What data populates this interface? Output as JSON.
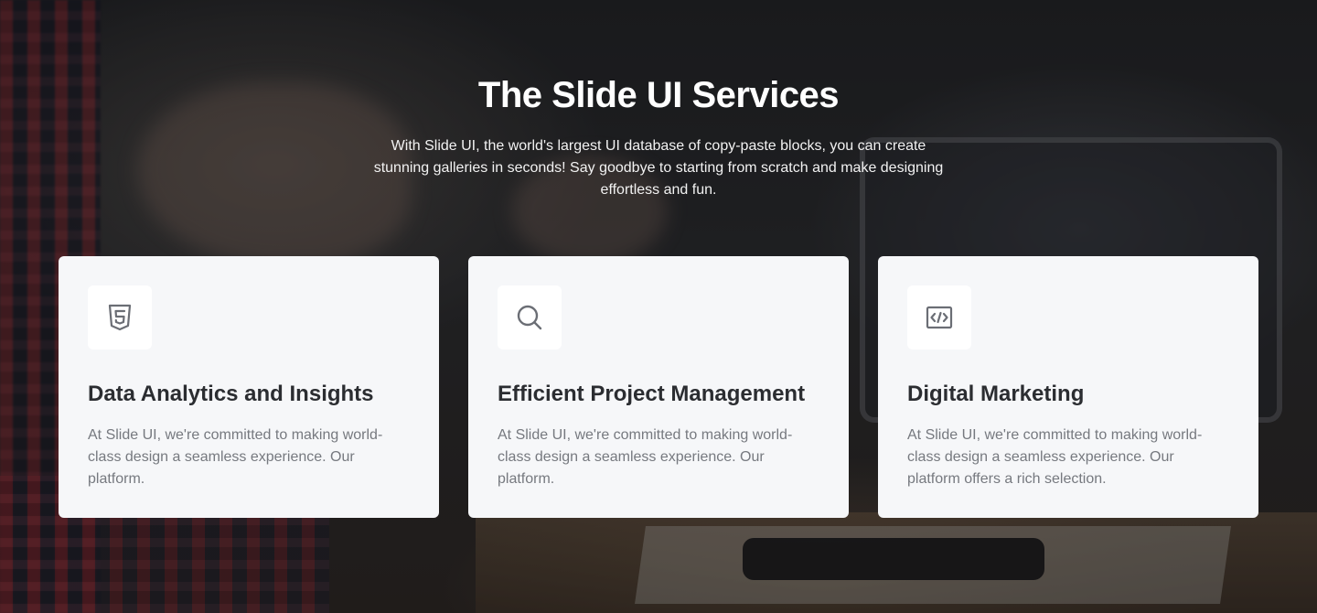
{
  "section": {
    "title": "The Slide UI Services",
    "description": "With Slide UI, the world's largest UI database of copy-paste blocks, you can create stunning galleries in seconds! Say goodbye to starting from scratch and make designing effortless and fun."
  },
  "cards": [
    {
      "icon": "html5-icon",
      "title": "Data Analytics and Insights",
      "description": "At Slide UI, we're committed to making world-class design a seamless experience. Our platform."
    },
    {
      "icon": "search-icon",
      "title": "Efficient Project Management",
      "description": "At Slide UI, we're committed to making world-class design a seamless experience. Our platform."
    },
    {
      "icon": "code-icon",
      "title": "Digital Marketing",
      "description": "At Slide UI, we're committed to making world-class design a seamless experience. Our platform offers a rich selection."
    }
  ],
  "colors": {
    "card_background": "#f6f7f9",
    "card_title": "#2b2d31",
    "card_text": "#76797f",
    "icon": "#6b6e75",
    "heading": "#ffffff"
  }
}
